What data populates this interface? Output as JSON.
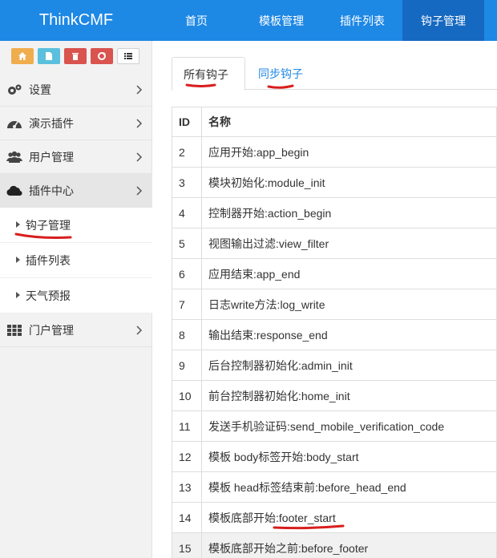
{
  "brand": "ThinkCMF",
  "nav": [
    {
      "label": "首页"
    },
    {
      "label": "模板管理"
    },
    {
      "label": "插件列表"
    },
    {
      "label": "钩子管理",
      "active": true
    }
  ],
  "colors": {
    "navbar": "#1e88e5",
    "nav_active": "#1669c0",
    "home_btn": "#f0ad4e",
    "doc_btn": "#5bc0de",
    "trash_btn": "#d9534f",
    "recycle_btn": "#d9534f",
    "link": "#1e88e5",
    "annotation": "#d81e1e"
  },
  "shortcuts": [
    "home-icon",
    "file-icon",
    "trash-icon",
    "recycle-icon",
    "list-icon"
  ],
  "sidebar": {
    "items": [
      {
        "label": "设置",
        "icon": "gears-icon"
      },
      {
        "label": "演示插件",
        "icon": "dashboard-icon"
      },
      {
        "label": "用户管理",
        "icon": "users-icon"
      },
      {
        "label": "插件中心",
        "icon": "cloud-icon",
        "open": true
      },
      {
        "label": "门户管理",
        "icon": "grid-icon"
      }
    ],
    "subitems": [
      {
        "label": "钩子管理"
      },
      {
        "label": "插件列表"
      },
      {
        "label": "天气预报"
      }
    ]
  },
  "tabs": {
    "all": "所有钩子",
    "sync": "同步钩子"
  },
  "table": {
    "headers": {
      "id": "ID",
      "name": "名称"
    },
    "rows": [
      {
        "id": "2",
        "name": "应用开始:app_begin"
      },
      {
        "id": "3",
        "name": "模块初始化:module_init"
      },
      {
        "id": "4",
        "name": "控制器开始:action_begin"
      },
      {
        "id": "5",
        "name": "视图输出过滤:view_filter"
      },
      {
        "id": "6",
        "name": "应用结束:app_end"
      },
      {
        "id": "7",
        "name": "日志write方法:log_write"
      },
      {
        "id": "8",
        "name": "输出结束:response_end"
      },
      {
        "id": "9",
        "name": "后台控制器初始化:admin_init"
      },
      {
        "id": "10",
        "name": "前台控制器初始化:home_init"
      },
      {
        "id": "11",
        "name": "发送手机验证码:send_mobile_verification_code"
      },
      {
        "id": "12",
        "name": "模板 body标签开始:body_start"
      },
      {
        "id": "13",
        "name": "模板 head标签结束前:before_head_end"
      },
      {
        "id": "14",
        "name": "模板底部开始:footer_start"
      },
      {
        "id": "15",
        "name": "模板底部开始之前:before_footer"
      }
    ]
  }
}
